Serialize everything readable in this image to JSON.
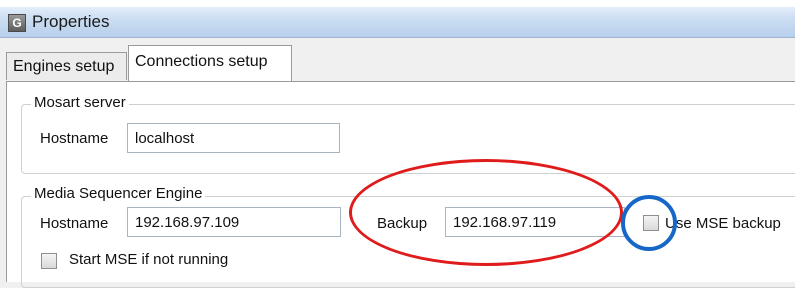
{
  "window": {
    "title": "Properties",
    "icon_letter": "G"
  },
  "tabs": [
    {
      "label": "Engines setup",
      "active": false
    },
    {
      "label": "Connections setup",
      "active": true
    }
  ],
  "mosart_server": {
    "title": "Mosart server",
    "hostname_label": "Hostname",
    "hostname_value": "localhost"
  },
  "mse": {
    "title": "Media Sequencer Engine",
    "hostname_label": "Hostname",
    "hostname_value": "192.168.97.109",
    "backup_label": "Backup",
    "backup_value": "192.168.97.119",
    "use_backup_label": "Use MSE backup",
    "use_backup_checked": false,
    "start_if_not_running_label": "Start MSE if not running",
    "start_if_not_running_checked": false
  },
  "annotations": {
    "ellipse_color": "#e01b1b",
    "circle_color": "#1667c7"
  }
}
